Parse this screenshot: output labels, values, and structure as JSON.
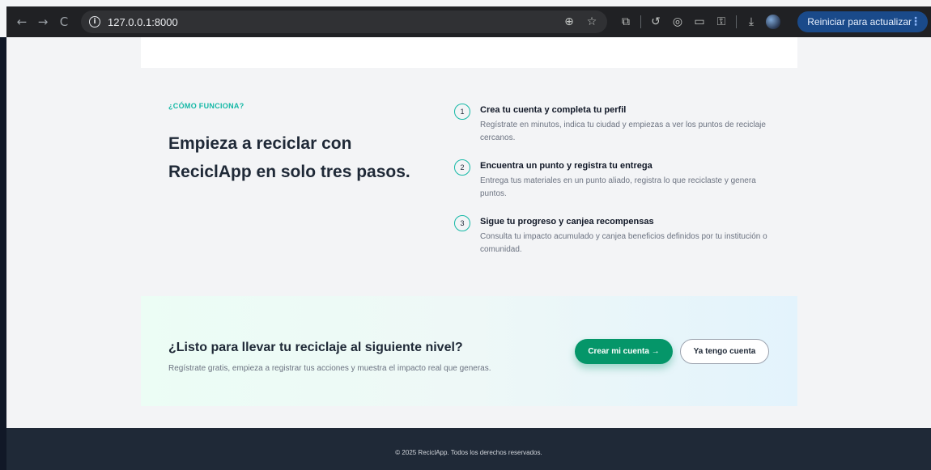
{
  "browser": {
    "url": "127.0.0.1:8000",
    "back_icon": "←",
    "forward_icon": "→",
    "reload_icon": "C",
    "info_icon": "i",
    "zoom_icon": "⊕",
    "star_icon": "☆",
    "extensions_icon": "⧉",
    "history_icon": "↺",
    "lens_icon": "◎",
    "cast_icon": "▭",
    "password_icon": "⚿",
    "download_icon": "⤓",
    "update_label": "Reiniciar para actualizar",
    "menu_icon": "⋮"
  },
  "how": {
    "label": "¿CÓMO FUNCIONA?",
    "title": "Empieza a reciclar con ReciclApp en solo tres pasos.",
    "steps": [
      {
        "number": "1",
        "title": "Crea tu cuenta y completa tu perfil",
        "description": "Regístrate en minutos, indica tu ciudad y empiezas a ver los puntos de reciclaje cercanos."
      },
      {
        "number": "2",
        "title": "Encuentra un punto y registra tu entrega",
        "description": "Entrega tus materiales en un punto aliado, registra lo que reciclaste y genera puntos."
      },
      {
        "number": "3",
        "title": "Sigue tu progreso y canjea recompensas",
        "description": "Consulta tu impacto acumulado y canjea beneficios definidos por tu institución o comunidad."
      }
    ]
  },
  "cta": {
    "title": "¿Listo para llevar tu reciclaje al siguiente nivel?",
    "subtitle": "Regístrate gratis, empieza a registrar tus acciones y muestra el impacto real que generas.",
    "primary_label": "Crear mi cuenta →",
    "secondary_label": "Ya tengo cuenta"
  },
  "footer": {
    "text": "© 2025 ReciclApp. Todos los derechos reservados."
  },
  "colors": {
    "accent": "#14b8a6",
    "primary_button": "#059669",
    "footer_bg": "#1f2937"
  }
}
